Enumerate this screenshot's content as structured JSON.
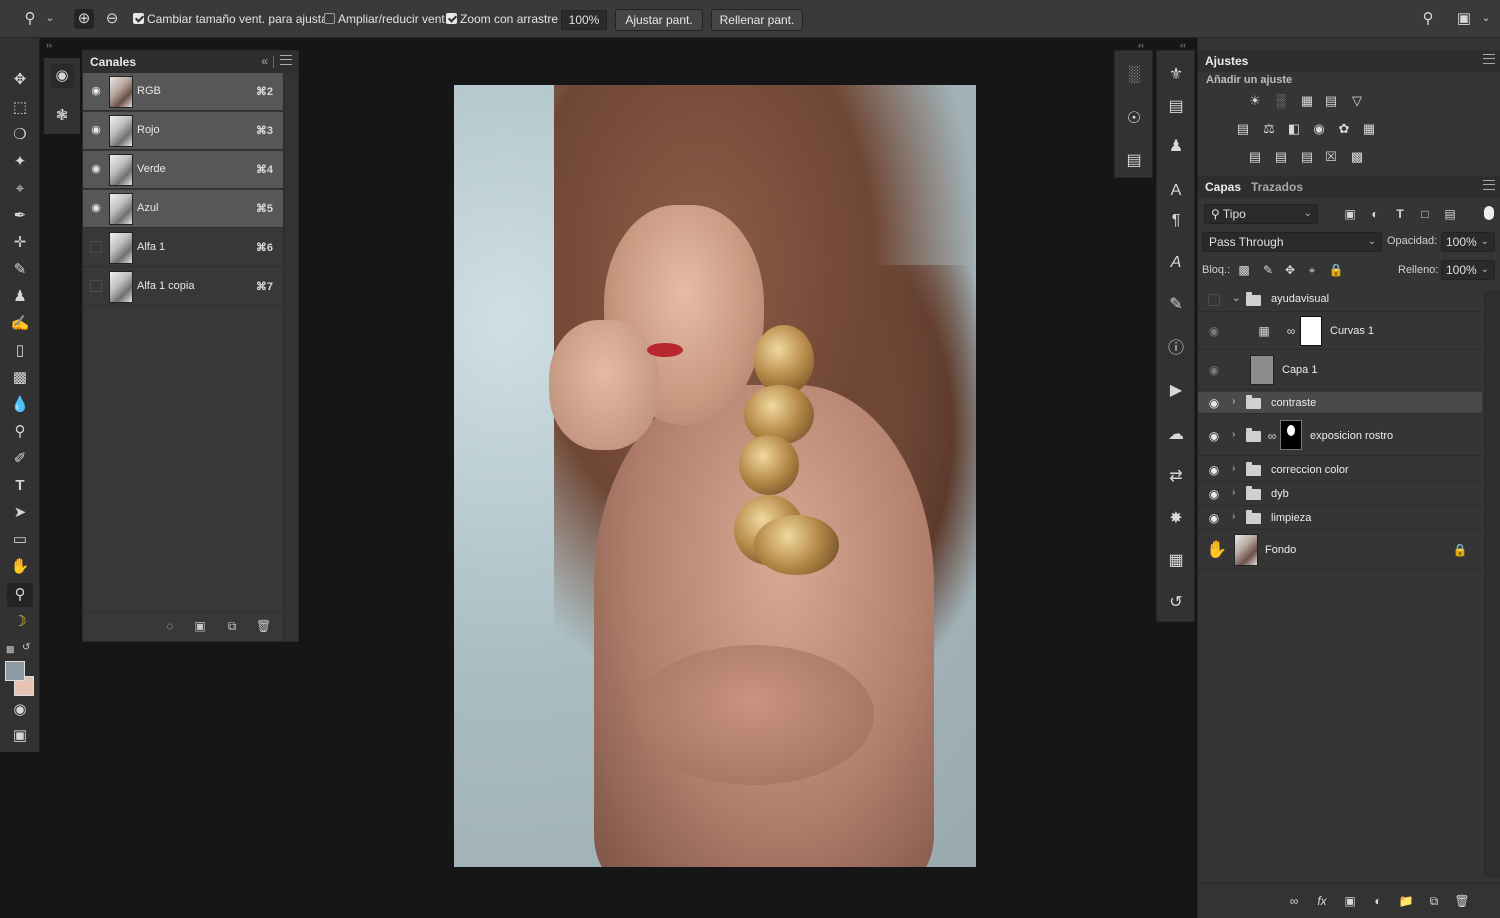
{
  "options_bar": {
    "zoom_tool_icon": "zoom-magnifier-icon",
    "zoom_in_icon": "zoom-in-icon",
    "zoom_out_icon": "zoom-out-icon",
    "resize_windows_label": "Cambiar tamaño vent. para ajustar",
    "resize_windows_checked": true,
    "zoom_all_windows_label": "Ampliar/reducir vent.",
    "zoom_all_windows_checked": false,
    "scrubby_zoom_label": "Zoom con arrastre",
    "scrubby_zoom_checked": true,
    "zoom_value": "100%",
    "fit_screen_button": "Ajustar pant.",
    "fill_screen_button": "Rellenar pant."
  },
  "channels_panel": {
    "title": "Canales",
    "channels": [
      {
        "name": "RGB",
        "shortcut": "⌘2",
        "visible": true,
        "selected": true
      },
      {
        "name": "Rojo",
        "shortcut": "⌘3",
        "visible": true,
        "selected": true
      },
      {
        "name": "Verde",
        "shortcut": "⌘4",
        "visible": true,
        "selected": true
      },
      {
        "name": "Azul",
        "shortcut": "⌘5",
        "visible": true,
        "selected": true
      },
      {
        "name": "Alfa 1",
        "shortcut": "⌘6",
        "visible": false,
        "selected": false
      },
      {
        "name": "Alfa 1 copia",
        "shortcut": "⌘7",
        "visible": false,
        "selected": false
      }
    ]
  },
  "adjustments_panel": {
    "title": "Ajustes",
    "subtitle": "Añadir un ajuste"
  },
  "layers_panel": {
    "tab_layers": "Capas",
    "tab_paths": "Trazados",
    "filter_kind": "Tipo",
    "blend_mode": "Pass Through",
    "opacity_label": "Opacidad:",
    "opacity_value": "100%",
    "lock_label": "Bloq.:",
    "fill_label": "Relleno:",
    "fill_value": "100%",
    "layers": [
      {
        "name": "ayudavisual",
        "type": "group",
        "expanded": true,
        "visible": false
      },
      {
        "name": "Curvas 1",
        "type": "adjustment-curves",
        "visible": false
      },
      {
        "name": "Capa 1",
        "type": "pixel",
        "visible": false
      },
      {
        "name": "contraste",
        "type": "group",
        "expanded": false,
        "visible": true,
        "selected": true
      },
      {
        "name": "exposicion rostro",
        "type": "group-masked",
        "expanded": false,
        "visible": true
      },
      {
        "name": "correccion color",
        "type": "group",
        "expanded": false,
        "visible": true
      },
      {
        "name": "dyb",
        "type": "group",
        "expanded": false,
        "visible": true
      },
      {
        "name": "limpieza",
        "type": "group",
        "expanded": false,
        "visible": true
      },
      {
        "name": "Fondo",
        "type": "background",
        "visible": true,
        "locked": true
      }
    ]
  },
  "colors": {
    "foreground": "#8c9aa4",
    "background": "#e6c2b4"
  }
}
